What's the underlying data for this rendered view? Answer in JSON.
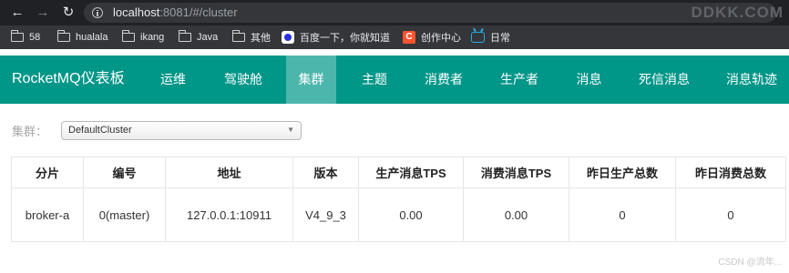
{
  "browser": {
    "url_host": "localhost",
    "url_rest": ":8081/#/cluster",
    "watermark": "DDKK.COM",
    "bookmarks": [
      {
        "label": "58",
        "icon": "folder-icon"
      },
      {
        "label": "hualala",
        "icon": "folder-icon"
      },
      {
        "label": "ikang",
        "icon": "folder-icon"
      },
      {
        "label": "Java",
        "icon": "folder-icon"
      },
      {
        "label": "其他",
        "icon": "folder-icon"
      },
      {
        "label": "百度一下，你就知道",
        "icon": "baidu-icon"
      },
      {
        "label": "创作中心",
        "icon": "csdn-icon"
      },
      {
        "label": "日常",
        "icon": "bilibili-icon"
      }
    ]
  },
  "app": {
    "brand": "RocketMQ仪表板",
    "nav": [
      "运维",
      "驾驶舱",
      "集群",
      "主题",
      "消费者",
      "生产者",
      "消息",
      "死信消息",
      "消息轨迹"
    ],
    "active_nav": "集群",
    "accent_color": "#009688",
    "active_color": "#4db6ac"
  },
  "cluster": {
    "label": "集群：",
    "selected": "DefaultCluster"
  },
  "table": {
    "headers": [
      "分片",
      "编号",
      "地址",
      "版本",
      "生产消息TPS",
      "消费消息TPS",
      "昨日生产总数",
      "昨日消费总数"
    ],
    "rows": [
      [
        "broker-a",
        "0(master)",
        "127.0.0.1:10911",
        "V4_9_3",
        "0.00",
        "0.00",
        "0",
        "0"
      ]
    ]
  },
  "footer_watermark": "CSDN @流年..."
}
